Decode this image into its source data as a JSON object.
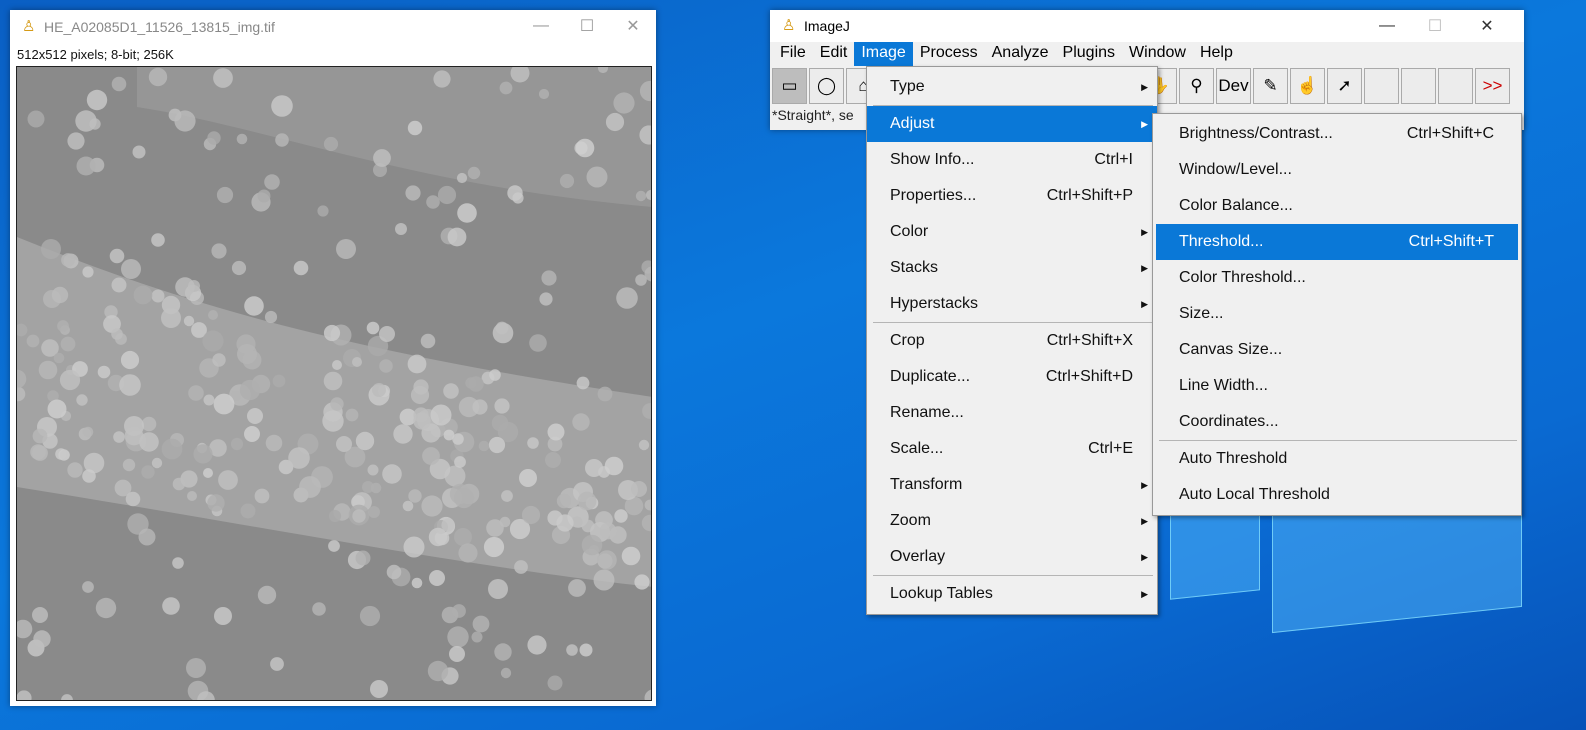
{
  "image_window": {
    "title": "HE_A02085D1_11526_13815_img.tif",
    "info": "512x512 pixels; 8-bit; 256K"
  },
  "imagej": {
    "title": "ImageJ",
    "menubar": [
      "File",
      "Edit",
      "Image",
      "Process",
      "Analyze",
      "Plugins",
      "Window",
      "Help"
    ],
    "tools": [
      "▭",
      "◯",
      "⌂",
      "",
      "",
      "",
      "",
      "",
      "",
      "",
      "✋",
      "⚲",
      "Dev",
      "✎",
      "☝",
      "➚",
      "",
      "",
      "",
      ">>"
    ],
    "status": "*Straight*, se"
  },
  "image_menu": [
    {
      "label": "Type",
      "submenu": true
    },
    {
      "sep": true
    },
    {
      "label": "Adjust",
      "submenu": true,
      "highlight": true
    },
    {
      "label": "Show Info...",
      "shortcut": "Ctrl+I"
    },
    {
      "label": "Properties...",
      "shortcut": "Ctrl+Shift+P"
    },
    {
      "label": "Color",
      "submenu": true
    },
    {
      "label": "Stacks",
      "submenu": true
    },
    {
      "label": "Hyperstacks",
      "submenu": true
    },
    {
      "sep": true
    },
    {
      "label": "Crop",
      "shortcut": "Ctrl+Shift+X"
    },
    {
      "label": "Duplicate...",
      "shortcut": "Ctrl+Shift+D"
    },
    {
      "label": "Rename..."
    },
    {
      "label": "Scale...",
      "shortcut": "Ctrl+E"
    },
    {
      "label": "Transform",
      "submenu": true
    },
    {
      "label": "Zoom",
      "submenu": true
    },
    {
      "label": "Overlay",
      "submenu": true
    },
    {
      "sep": true
    },
    {
      "label": "Lookup Tables",
      "submenu": true
    }
  ],
  "adjust_menu": [
    {
      "label": "Brightness/Contrast...",
      "shortcut": "Ctrl+Shift+C"
    },
    {
      "label": "Window/Level..."
    },
    {
      "label": "Color Balance..."
    },
    {
      "label": "Threshold...",
      "shortcut": "Ctrl+Shift+T",
      "highlight": true
    },
    {
      "label": "Color Threshold..."
    },
    {
      "label": "Size..."
    },
    {
      "label": "Canvas Size..."
    },
    {
      "label": "Line Width..."
    },
    {
      "label": "Coordinates..."
    },
    {
      "sep": true
    },
    {
      "label": "Auto Threshold"
    },
    {
      "label": "Auto Local Threshold"
    }
  ]
}
